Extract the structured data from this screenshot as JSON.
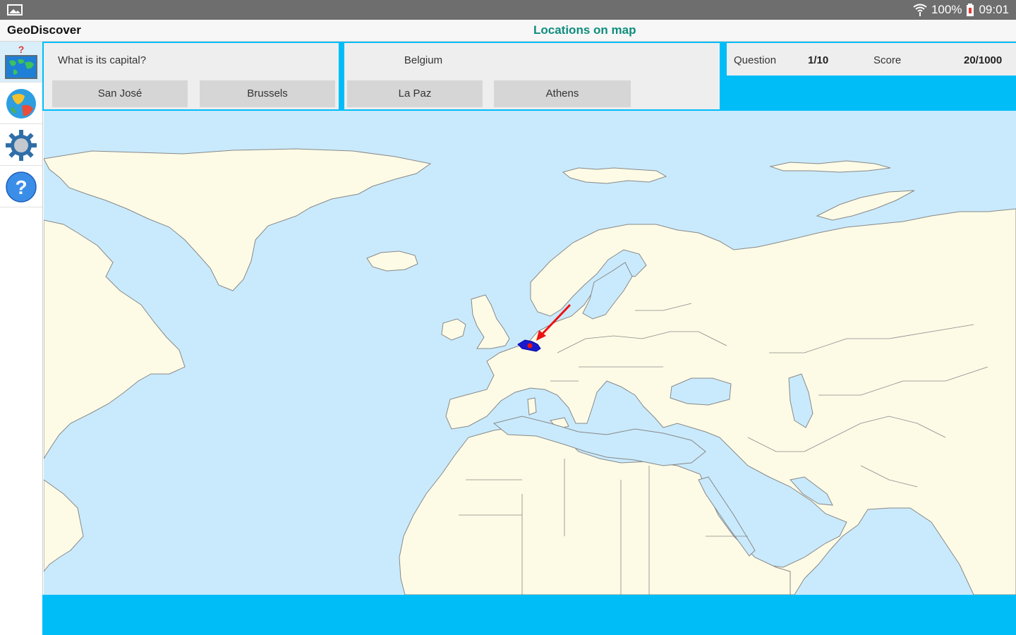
{
  "status_bar": {
    "left_icon": "gallery-icon",
    "wifi_icon": "wifi-icon",
    "battery_percent": "100%",
    "battery_icon": "battery-icon",
    "time": "09:01"
  },
  "title_bar": {
    "app_name": "GeoDiscover",
    "screen_title": "Locations on map"
  },
  "sidebar": {
    "items": [
      {
        "icon": "map-quiz-icon",
        "active": true
      },
      {
        "icon": "globe-icon",
        "active": false
      },
      {
        "icon": "gear-icon",
        "active": false
      },
      {
        "icon": "help-icon",
        "active": false
      }
    ]
  },
  "quiz": {
    "question": "What is its capital?",
    "country": "Belgium",
    "answers": [
      "San José",
      "Brussels",
      "La Paz",
      "Athens"
    ],
    "question_label": "Question",
    "question_progress": "1/10",
    "score_label": "Score",
    "score_value": "20/1000"
  },
  "map": {
    "highlighted_country": "Belgium",
    "land_color": "#fdfbe6",
    "sea_color": "#c9eafc",
    "highlight_color": "#1a1acc",
    "marker_color": "#ee1111",
    "accent_color": "#00bdf7"
  }
}
